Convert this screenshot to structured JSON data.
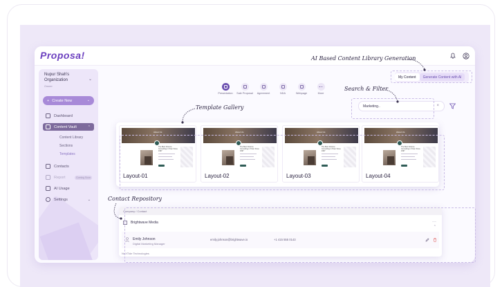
{
  "app": {
    "logo": "Proposa!"
  },
  "sidebar": {
    "org_name": "Nupur Shah's Organization",
    "org_role": "Owner",
    "create_label": "Create New",
    "items": [
      {
        "label": "Dashboard",
        "icon": "home-icon"
      },
      {
        "label": "Content Vault",
        "icon": "vault-icon"
      },
      {
        "label": "Contacts",
        "icon": "contacts-icon"
      },
      {
        "label": "Report",
        "icon": "report-icon",
        "badge": "Coming Soon"
      },
      {
        "label": "AI Usage",
        "icon": "chart-icon"
      },
      {
        "label": "Settings",
        "icon": "gear-icon"
      }
    ],
    "sub_items": [
      "Content Library",
      "Sections",
      "Templates"
    ]
  },
  "toolbar": {
    "items": [
      "Presentation",
      "Sale Proposal",
      "Agreement",
      "NDA",
      "Webpage",
      "More"
    ]
  },
  "tabs": {
    "my_content": "My Content",
    "generate": "Generate Content with AI"
  },
  "search": {
    "value": "Marketing.."
  },
  "gallery": {
    "cards": [
      {
        "label": "Layout-01",
        "hero_text": "About Us",
        "headline": "The Best Finance Consulting in Town Since 1997"
      },
      {
        "label": "Layout-02",
        "hero_text": "About Us",
        "headline": "The Best Finance Consulting in Town Since 1997"
      },
      {
        "label": "Layout-03",
        "hero_text": "About Us",
        "headline": "The Best Finance Consulting in Town Since 1997"
      },
      {
        "label": "Layout-04",
        "hero_text": "About Us",
        "headline": "The Best Finance Consulting in Town Since 1997"
      }
    ]
  },
  "contacts": {
    "header": "Company / Contact",
    "company": "Brightwave Media",
    "person": {
      "name": "Emily Johnson",
      "title": "Digital Marketing Manager",
      "email": "emily.johnson@brightwave.io",
      "phone": "+1 415 555 0143"
    },
    "next_row": "NeXTide Technologies"
  },
  "annotations": {
    "ai_library": "AI Based Content Library Generation",
    "search_filter": "Search & Filter",
    "template_gallery": "Template Gallery",
    "contact_repository": "Contact Repository"
  },
  "colors": {
    "brand": "#6b3fbf",
    "accent": "#a88ad8",
    "sidebar_bg": "#ede6f9",
    "page_bg": "#eee8f8"
  }
}
